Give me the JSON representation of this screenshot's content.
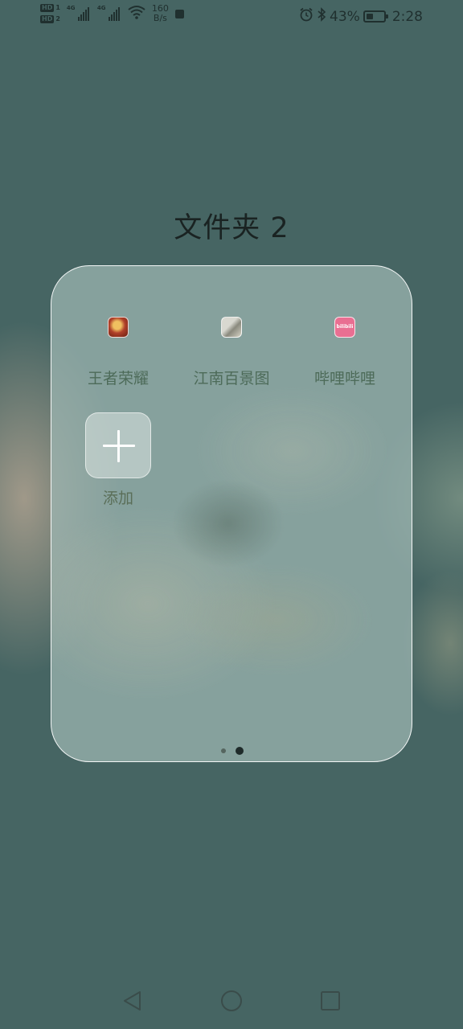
{
  "status_bar": {
    "hd1": "HD",
    "hd2": "HD",
    "sim1_index": "1",
    "sim2_index": "2",
    "net1": "4G",
    "net2": "4G",
    "speed_value": "160",
    "speed_unit": "B/s",
    "battery_percent": "43%",
    "battery_level": 0.43,
    "time": "2:28"
  },
  "folder": {
    "title": "文件夹 2",
    "apps": [
      {
        "label": "王者荣耀",
        "icon": "honor-of-kings-icon"
      },
      {
        "label": "江南百景图",
        "icon": "jiangnan-baijingtu-icon"
      },
      {
        "label": "哔哩哔哩",
        "icon": "bilibili-icon",
        "icon_text": "bilibili"
      }
    ],
    "add_label": "添加",
    "pages": 2,
    "current_page": 2
  },
  "nav": {
    "back": "back-icon",
    "home": "home-icon",
    "recent": "recent-apps-icon"
  }
}
